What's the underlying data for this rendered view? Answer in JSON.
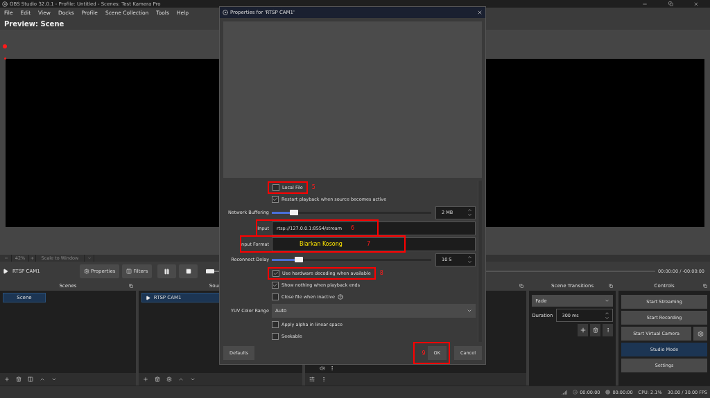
{
  "window": {
    "title": "OBS Studio 32.0.1 - Profile: Untitled - Scenes: Test Kamera Pro"
  },
  "menu": [
    "File",
    "Edit",
    "View",
    "Docks",
    "Profile",
    "Scene Collection",
    "Tools",
    "Help"
  ],
  "preview": {
    "title": "Preview: Scene"
  },
  "zoom_bar": {
    "minus": "−",
    "zoom": "42%",
    "plus": "+",
    "scale": "Scale to Window"
  },
  "source_bar": {
    "source": "RTSP CAM1",
    "properties": "Properties",
    "filters": "Filters",
    "volume": {
      "level": 0
    },
    "time": "00:00:00 / -00:00:00"
  },
  "scenes": {
    "title": "Scenes",
    "items": [
      {
        "label": "Scene",
        "selected": true
      }
    ]
  },
  "sources": {
    "title": "Sour",
    "items": [
      {
        "label": "RTSP CAM1",
        "selected": true
      }
    ]
  },
  "transitions": {
    "title": "Scene Transitions",
    "transition": "Fade",
    "duration_label": "Duration",
    "duration": "300 ms"
  },
  "controls": {
    "title": "Controls",
    "buttons": [
      {
        "label": "Start Streaming",
        "selected": false
      },
      {
        "label": "Start Recording",
        "selected": false
      },
      {
        "label": "Start Virtual Camera",
        "selected": false
      },
      {
        "label": "Studio Mode",
        "selected": true
      },
      {
        "label": "Settings",
        "selected": false
      }
    ]
  },
  "status_bar": {
    "stream_time": "00:00:00",
    "record_time": "00:00:00",
    "cpu": "CPU: 2.1%",
    "fps": "30.00 / 30.00 FPS"
  },
  "dialog": {
    "title": "Properties for 'RTSP CAM1'",
    "properties": [
      {
        "kind": "checkbox",
        "label": "Local File",
        "checked": false,
        "marker": "5"
      },
      {
        "kind": "checkbox",
        "label": "Restart playback when source becomes active",
        "checked": true
      },
      {
        "kind": "slider",
        "label": "Network Buffering",
        "level": 0.14,
        "value": "2 MB"
      },
      {
        "kind": "text",
        "label": "Input",
        "value": "rtsp://127.0.0.1:8554/stream",
        "marker": "6"
      },
      {
        "kind": "text",
        "label": "nput Format",
        "note": "Biarkan Kosong",
        "marker": "7"
      },
      {
        "kind": "slider",
        "label": "Reconnect Delay",
        "level": 0.17,
        "value": "10 S"
      },
      {
        "kind": "checkbox",
        "label": "Use hardware decoding when available",
        "checked": true,
        "marker": "8"
      },
      {
        "kind": "checkbox",
        "label": "Show nothing when playback ends",
        "checked": true
      },
      {
        "kind": "checkbox",
        "label": "Close file when inactive",
        "checked": false,
        "help": true
      },
      {
        "kind": "combo",
        "label": "YUV Color Range",
        "value": "Auto"
      },
      {
        "kind": "checkbox",
        "label": "Apply alpha in linear space",
        "checked": false
      },
      {
        "kind": "checkbox",
        "label": "Seekable",
        "checked": false
      }
    ],
    "buttons": [
      {
        "kind": "defaults",
        "label": "Defaults"
      },
      {
        "kind": "ok",
        "label": "OK",
        "marker": "9"
      },
      {
        "kind": "cancel",
        "label": "Cancel"
      }
    ]
  }
}
